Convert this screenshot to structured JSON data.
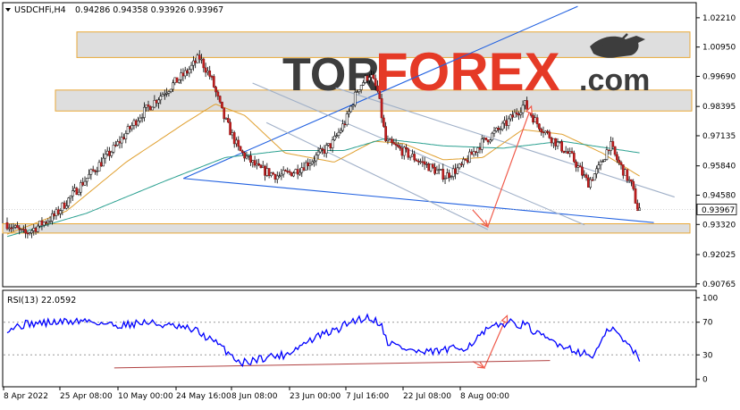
{
  "chart_data": [
    {
      "type": "candlestick",
      "header": {
        "symbol": "USDCHFi,H4",
        "ohlc": "0.94286 0.94358 0.93926 0.93967"
      },
      "y_ticks": [
        "1.02210",
        "1.00950",
        "0.99690",
        "0.98395",
        "0.97135",
        "0.95840",
        "0.94580",
        "0.93320",
        "0.92025",
        "0.90765"
      ],
      "y_tick_values": [
        1.0221,
        1.0095,
        0.9969,
        0.98395,
        0.97135,
        0.9584,
        0.9458,
        0.9332,
        0.92025,
        0.90765
      ],
      "ylim": [
        0.9068,
        1.0282
      ],
      "current_price_label": "0.93967",
      "current_price": 0.93967,
      "x_ticks": [
        "8 Apr 2022",
        "25 Apr 08:00",
        "10 May 00:00",
        "24 May 16:00",
        "8 Jun 08:00",
        "23 Jun 00:00",
        "7 Jul 16:00",
        "22 Jul 08:00",
        "8 Aug 00:00"
      ],
      "bars_count": 310,
      "path_anchors": [
        [
          0,
          0.934
        ],
        [
          10,
          0.929
        ],
        [
          25,
          0.937
        ],
        [
          40,
          0.952
        ],
        [
          55,
          0.966
        ],
        [
          68,
          0.98
        ],
        [
          80,
          0.99
        ],
        [
          92,
          0.999
        ],
        [
          98,
          1.005
        ],
        [
          104,
          0.996
        ],
        [
          110,
          0.98
        ],
        [
          118,
          0.965
        ],
        [
          128,
          0.957
        ],
        [
          138,
          0.954
        ],
        [
          146,
          0.956
        ],
        [
          155,
          0.961
        ],
        [
          165,
          0.968
        ],
        [
          172,
          0.978
        ],
        [
          178,
          0.992
        ],
        [
          184,
          0.998
        ],
        [
          188,
          0.99
        ],
        [
          192,
          0.969
        ],
        [
          200,
          0.965
        ],
        [
          210,
          0.96
        ],
        [
          222,
          0.954
        ],
        [
          230,
          0.958
        ],
        [
          240,
          0.968
        ],
        [
          252,
          0.976
        ],
        [
          262,
          0.985
        ],
        [
          268,
          0.977
        ],
        [
          276,
          0.97
        ],
        [
          286,
          0.962
        ],
        [
          294,
          0.951
        ],
        [
          300,
          0.958
        ],
        [
          305,
          0.968
        ],
        [
          308,
          0.962
        ],
        [
          312,
          0.956
        ],
        [
          316,
          0.95
        ],
        [
          319,
          0.94
        ]
      ],
      "moving_averages": [
        {
          "color": "#e0a030",
          "anchors": [
            [
              0,
              0.929
            ],
            [
              30,
              0.939
            ],
            [
              60,
              0.96
            ],
            [
              90,
              0.977
            ],
            [
              105,
              0.985
            ],
            [
              120,
              0.98
            ],
            [
              140,
              0.964
            ],
            [
              165,
              0.96
            ],
            [
              185,
              0.969
            ],
            [
              200,
              0.968
            ],
            [
              220,
              0.961
            ],
            [
              240,
              0.962
            ],
            [
              260,
              0.974
            ],
            [
              280,
              0.972
            ],
            [
              300,
              0.964
            ],
            [
              319,
              0.954
            ]
          ]
        },
        {
          "color": "#2aa090",
          "anchors": [
            [
              0,
              0.928
            ],
            [
              40,
              0.938
            ],
            [
              80,
              0.952
            ],
            [
              110,
              0.962
            ],
            [
              140,
              0.965
            ],
            [
              170,
              0.965
            ],
            [
              190,
              0.97
            ],
            [
              220,
              0.967
            ],
            [
              250,
              0.966
            ],
            [
              280,
              0.969
            ],
            [
              319,
              0.964
            ]
          ]
        }
      ],
      "zones": [
        {
          "low": 1.005,
          "high": 1.016
        },
        {
          "low": 0.982,
          "high": 0.991
        },
        {
          "low": 0.9295,
          "high": 0.9335
        }
      ],
      "trend_lines": [
        {
          "color": "#2060e0",
          "from": [
            0.26,
            0.953
          ],
          "to": [
            0.83,
            1.027
          ]
        },
        {
          "color": "#2060e0",
          "from": [
            0.26,
            0.953
          ],
          "to": [
            0.94,
            0.934
          ]
        },
        {
          "color": "#a0b0c8",
          "from": [
            0.36,
            0.994
          ],
          "to": [
            0.84,
            0.933
          ]
        },
        {
          "color": "#a0b0c8",
          "from": [
            0.38,
            0.977
          ],
          "to": [
            0.7,
            0.931
          ]
        },
        {
          "color": "#a0b0c8",
          "from": [
            0.48,
            0.992
          ],
          "to": [
            0.97,
            0.945
          ]
        }
      ],
      "forecast_arrow": {
        "color": "#f05a4a",
        "points": [
          [
            0.678,
            0.9395
          ],
          [
            0.7,
            0.9322
          ],
          [
            0.763,
            0.984
          ]
        ]
      }
    },
    {
      "type": "line",
      "label": "RSI(13) 22.0592",
      "y_ticks": [
        "100",
        "70",
        "30",
        "0"
      ],
      "y_tick_values": [
        100,
        70,
        30,
        0
      ],
      "ylim": [
        -8,
        108
      ],
      "line_color": "#0000ff",
      "anchors": [
        [
          0,
          62
        ],
        [
          10,
          68
        ],
        [
          25,
          70
        ],
        [
          40,
          72
        ],
        [
          55,
          66
        ],
        [
          70,
          70
        ],
        [
          85,
          64
        ],
        [
          95,
          60
        ],
        [
          105,
          45
        ],
        [
          112,
          32
        ],
        [
          118,
          20
        ],
        [
          125,
          24
        ],
        [
          132,
          28
        ],
        [
          140,
          30
        ],
        [
          150,
          44
        ],
        [
          158,
          54
        ],
        [
          166,
          60
        ],
        [
          174,
          72
        ],
        [
          182,
          76
        ],
        [
          188,
          70
        ],
        [
          192,
          46
        ],
        [
          200,
          38
        ],
        [
          210,
          32
        ],
        [
          222,
          36
        ],
        [
          232,
          40
        ],
        [
          242,
          60
        ],
        [
          252,
          70
        ],
        [
          262,
          66
        ],
        [
          268,
          54
        ],
        [
          276,
          46
        ],
        [
          286,
          36
        ],
        [
          295,
          28
        ],
        [
          300,
          46
        ],
        [
          304,
          64
        ],
        [
          308,
          56
        ],
        [
          312,
          44
        ],
        [
          316,
          36
        ],
        [
          319,
          22
        ]
      ],
      "support_line": {
        "color": "#b04040",
        "from": [
          0.16,
          14
        ],
        "to": [
          0.79,
          23
        ]
      },
      "forecast_arrow": {
        "color": "#f05a4a",
        "points": [
          [
            0.678,
            22
          ],
          [
            0.695,
            14
          ],
          [
            0.728,
            78
          ]
        ]
      }
    }
  ],
  "watermark": {
    "left": "TOR",
    "right": "FOREX",
    "domain": ".com"
  }
}
